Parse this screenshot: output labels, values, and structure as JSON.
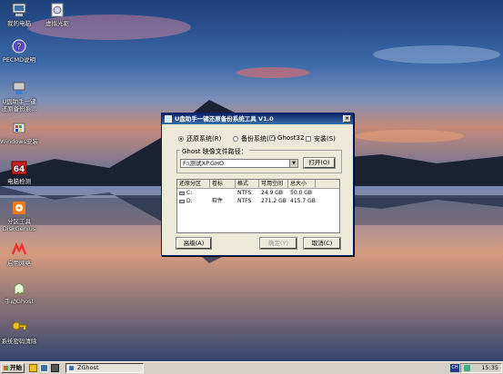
{
  "desktop_icons": [
    {
      "label": "我的电脑",
      "icon": "computer-icon"
    },
    {
      "label": "虚拟光驱",
      "icon": "cd-icon"
    },
    {
      "label": "PECMD说明",
      "icon": "help-icon"
    },
    {
      "label": "U盘助手一键",
      "label2": "还原备份系...",
      "icon": "backup-tool-icon"
    },
    {
      "label": "Windows安装",
      "icon": "windows-setup-icon"
    },
    {
      "label": "电脑检测",
      "icon": "hardware-check-icon",
      "badge": "64"
    },
    {
      "label": "分区工具",
      "label2": "DiskGenius",
      "icon": "diskgenius-icon"
    },
    {
      "label": "启用网络",
      "icon": "network-icon"
    },
    {
      "label": "手动Ghost",
      "icon": "ghost-icon"
    },
    {
      "label": "系统密码清除",
      "icon": "key-icon"
    }
  ],
  "dialog": {
    "title": "U盘助手一键还原备份系统工具 V1.0",
    "close_label": "×",
    "mode_restore": "还原系统(R)",
    "mode_backup": "备份系统(B)",
    "ghost32_label": "Ghost32",
    "install_label": "安装(S)",
    "ghost32_checked": true,
    "install_checked": false,
    "restore_selected": true,
    "image_path_label": "Ghost 映像文件路径：",
    "image_path_value": "F:\\测试XP.GHO",
    "open_button": "打开(O)",
    "table": {
      "headers": [
        "还原分区",
        "卷标",
        "格式",
        "可用空间",
        "总大小"
      ],
      "rows": [
        [
          "C:",
          "",
          "NTFS",
          "24.9 GB",
          "50.0 GB"
        ],
        [
          "D:",
          "软件",
          "NTFS",
          "271.2 GB",
          "415.7 GB"
        ]
      ]
    },
    "advanced_button": "高级(A)",
    "ok_button": "确定(Y)",
    "cancel_button": "取消(C)"
  },
  "taskbar": {
    "start_label": "开始",
    "task_label": "ZGhost",
    "lang_label": "CH",
    "clock": "15:35"
  },
  "colors": {
    "title_bar": "#0a246a",
    "dialog_bg": "#ece9d8",
    "taskbar_bg": "#d4d0c8"
  }
}
